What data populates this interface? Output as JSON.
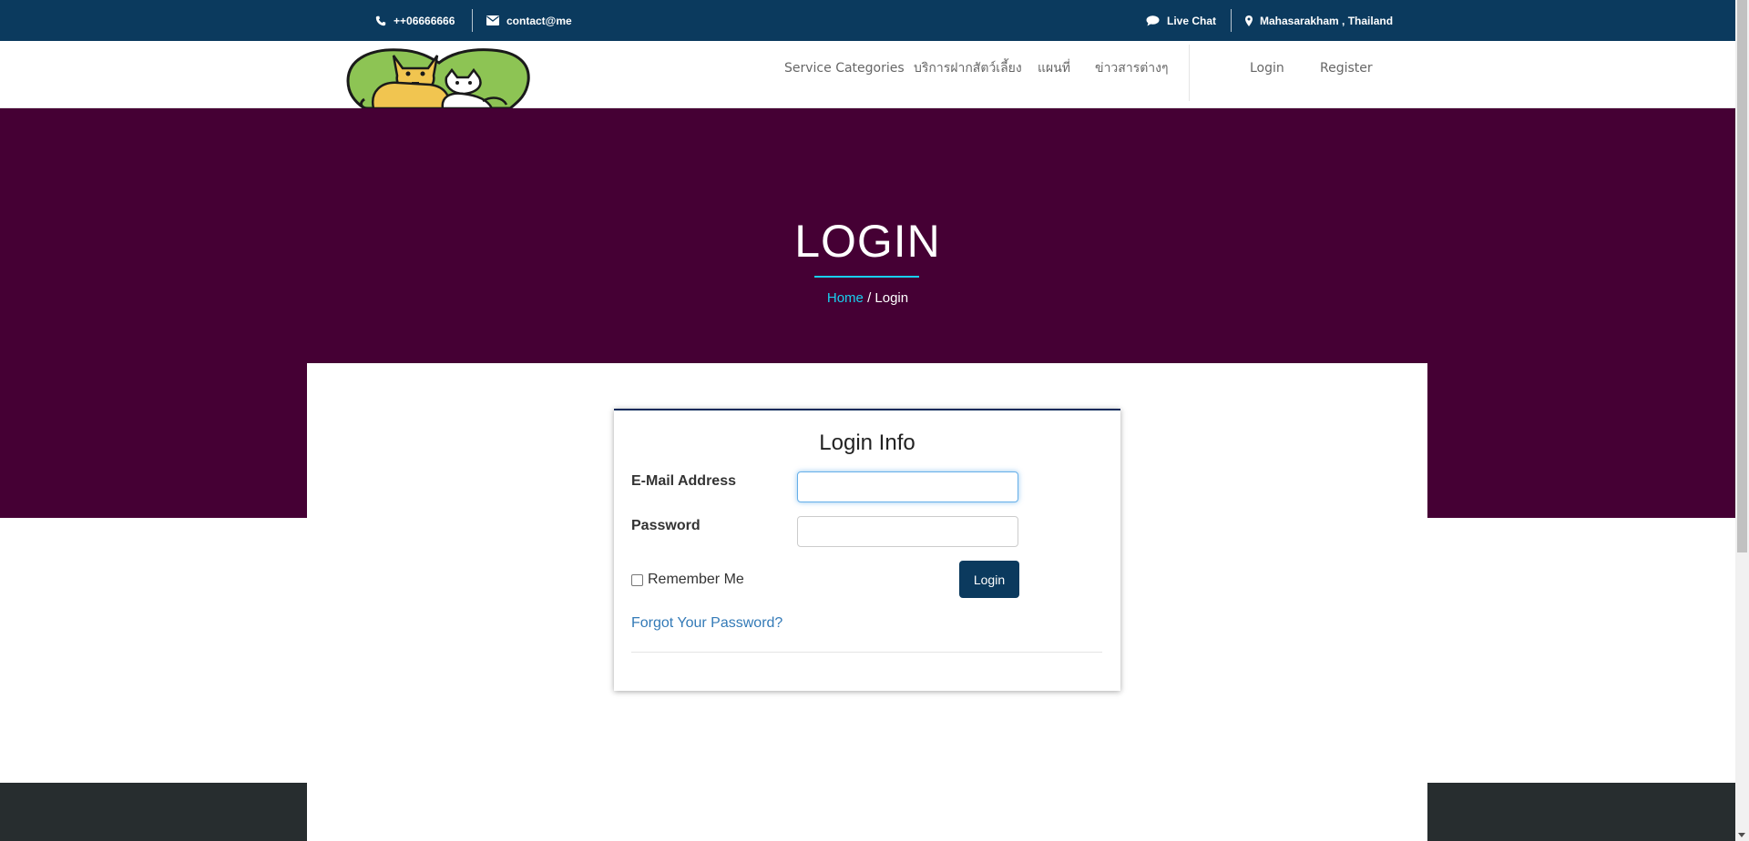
{
  "topbar": {
    "phone": "++06666666",
    "email": "contact@me",
    "live_chat": "Live Chat",
    "location": "Mahasarakham , Thailand",
    "icons": [
      "phone-icon",
      "envelope-icon",
      "chat-bubble-icon",
      "map-marker-icon"
    ]
  },
  "nav": {
    "items": [
      {
        "label": "Service Categories"
      },
      {
        "label": "บริการฝากสัตว์เลี้ยง"
      },
      {
        "label": "แผนที่"
      },
      {
        "label": "ข่าวสารต่างๆ"
      }
    ],
    "login": "Login",
    "register": "Register"
  },
  "hero": {
    "title": "LOGIN",
    "breadcrumb_home": "Home",
    "breadcrumb_sep": "/",
    "breadcrumb_current": "Login"
  },
  "login_form": {
    "title": "Login Info",
    "email_label": "E-Mail Address",
    "email_value": "",
    "password_label": "Password",
    "password_value": "",
    "remember_label": "Remember Me",
    "remember_checked": false,
    "submit_label": "Login",
    "forgot_label": "Forgot Your Password?"
  },
  "colors": {
    "topbar_bg": "#0b3a5e",
    "hero_bg": "#450034",
    "accent_cyan": "#18d0f0",
    "link_blue": "#337ab7",
    "footer_bg": "#272d2f"
  }
}
